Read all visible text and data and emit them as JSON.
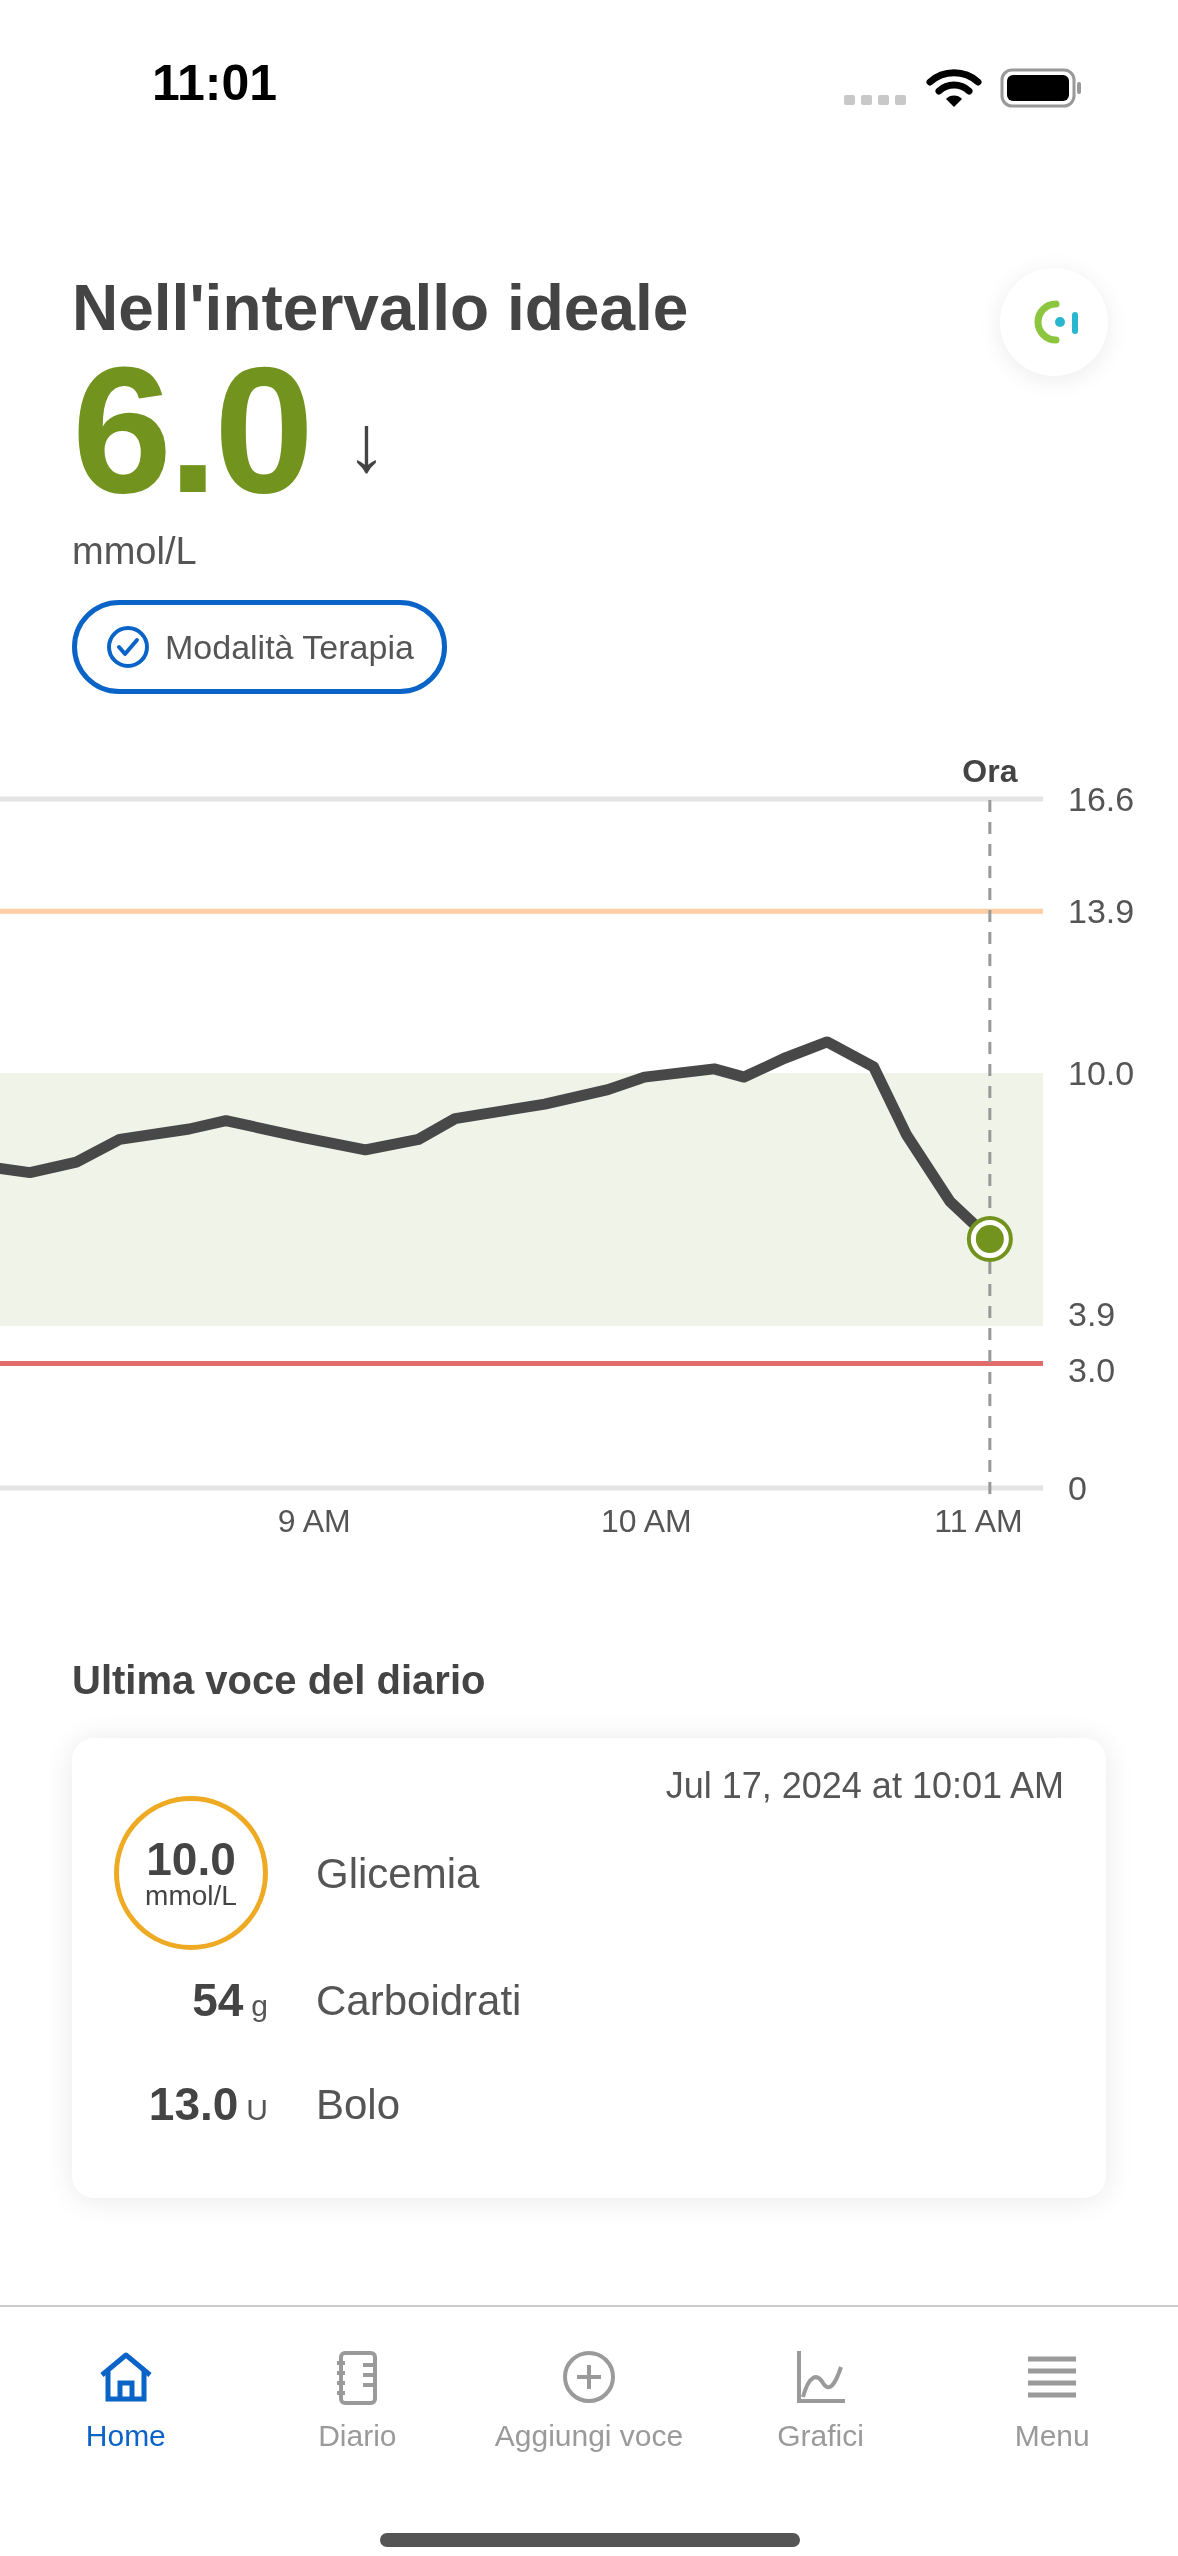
{
  "status_bar": {
    "time": "11:01"
  },
  "header": {
    "title": "Nell'intervallo ideale",
    "value": "6.0",
    "trend_arrow": "↓",
    "unit": "mmol/L",
    "mode_badge": {
      "label": "Modalità Terapia",
      "checked": true
    }
  },
  "chart": {
    "chart_data": {
      "type": "line",
      "xlim": [
        8.03,
        11.17
      ],
      "ylim": [
        0,
        16.6
      ],
      "xticks": [
        {
          "value": 9,
          "label": "9 AM"
        },
        {
          "value": 10,
          "label": "10 AM"
        },
        {
          "value": 11,
          "label": "11 AM"
        }
      ],
      "yticks": [
        {
          "value": 0,
          "label": "0"
        },
        {
          "value": 3.0,
          "label": "3.0"
        },
        {
          "value": 3.9,
          "label": "3.9"
        },
        {
          "value": 10.0,
          "label": "10.0"
        },
        {
          "value": 13.9,
          "label": "13.9"
        },
        {
          "value": 16.6,
          "label": "16.6"
        }
      ],
      "x": [
        8.03,
        8.12,
        8.26,
        8.39,
        8.6,
        8.71,
        8.94,
        9.13,
        9.29,
        9.4,
        9.67,
        9.86,
        9.97,
        10.18,
        10.27,
        10.39,
        10.52,
        10.66,
        10.76,
        10.89,
        11.01
      ],
      "series": [
        {
          "color": "#484848",
          "values": [
            7.7,
            7.6,
            7.85,
            8.4,
            8.65,
            8.85,
            8.45,
            8.15,
            8.4,
            8.9,
            9.25,
            9.6,
            9.9,
            10.1,
            9.9,
            10.35,
            10.75,
            10.15,
            8.5,
            6.9,
            6.0
          ]
        }
      ],
      "bands": [
        {
          "axis": "y",
          "from": 3.9,
          "to": 10.0,
          "color": "#f0f3e8"
        }
      ],
      "ref_lines": [
        {
          "axis": "y",
          "value": 13.9,
          "color": "#fdcda3"
        },
        {
          "axis": "y",
          "value": 3.0,
          "color": "#e26b6b"
        },
        {
          "axis": "x",
          "value": 11.01,
          "label": "Ora",
          "color": "#999999"
        }
      ]
    }
  },
  "diary": {
    "title": "Ultima voce del diario",
    "date": "Jul 17, 2024 at 10:01 AM",
    "entries": [
      {
        "kind": "ring",
        "value": "10.0",
        "unit": "mmol/L",
        "label": "Glicemia",
        "color": "#eeaa22"
      },
      {
        "kind": "plain",
        "value": "54",
        "unit": "g",
        "label": "Carboidrati"
      },
      {
        "kind": "plain",
        "value": "13.0",
        "unit": "U",
        "label": "Bolo"
      }
    ]
  },
  "tab_bar": [
    {
      "label": "Home",
      "selected": true
    },
    {
      "label": "Diario",
      "selected": false
    },
    {
      "label": "Aggiungi voce",
      "selected": false
    },
    {
      "label": "Grafici",
      "selected": false
    },
    {
      "label": "Menu",
      "selected": false
    }
  ]
}
